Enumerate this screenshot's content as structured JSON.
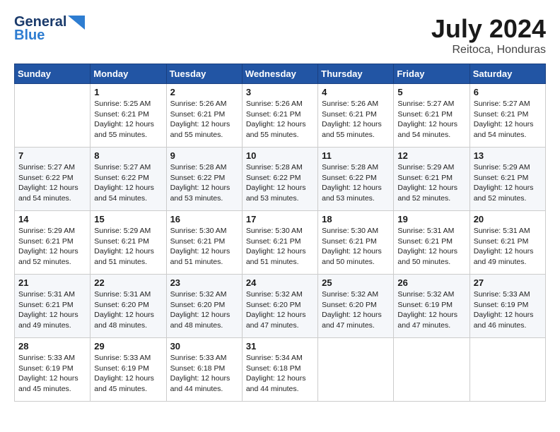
{
  "header": {
    "logo_line1": "General",
    "logo_line2": "Blue",
    "month": "July 2024",
    "location": "Reitoca, Honduras"
  },
  "days_of_week": [
    "Sunday",
    "Monday",
    "Tuesday",
    "Wednesday",
    "Thursday",
    "Friday",
    "Saturday"
  ],
  "weeks": [
    [
      {
        "day": "",
        "info": ""
      },
      {
        "day": "1",
        "info": "Sunrise: 5:25 AM\nSunset: 6:21 PM\nDaylight: 12 hours\nand 55 minutes."
      },
      {
        "day": "2",
        "info": "Sunrise: 5:26 AM\nSunset: 6:21 PM\nDaylight: 12 hours\nand 55 minutes."
      },
      {
        "day": "3",
        "info": "Sunrise: 5:26 AM\nSunset: 6:21 PM\nDaylight: 12 hours\nand 55 minutes."
      },
      {
        "day": "4",
        "info": "Sunrise: 5:26 AM\nSunset: 6:21 PM\nDaylight: 12 hours\nand 55 minutes."
      },
      {
        "day": "5",
        "info": "Sunrise: 5:27 AM\nSunset: 6:21 PM\nDaylight: 12 hours\nand 54 minutes."
      },
      {
        "day": "6",
        "info": "Sunrise: 5:27 AM\nSunset: 6:21 PM\nDaylight: 12 hours\nand 54 minutes."
      }
    ],
    [
      {
        "day": "7",
        "info": "Sunrise: 5:27 AM\nSunset: 6:22 PM\nDaylight: 12 hours\nand 54 minutes."
      },
      {
        "day": "8",
        "info": "Sunrise: 5:27 AM\nSunset: 6:22 PM\nDaylight: 12 hours\nand 54 minutes."
      },
      {
        "day": "9",
        "info": "Sunrise: 5:28 AM\nSunset: 6:22 PM\nDaylight: 12 hours\nand 53 minutes."
      },
      {
        "day": "10",
        "info": "Sunrise: 5:28 AM\nSunset: 6:22 PM\nDaylight: 12 hours\nand 53 minutes."
      },
      {
        "day": "11",
        "info": "Sunrise: 5:28 AM\nSunset: 6:22 PM\nDaylight: 12 hours\nand 53 minutes."
      },
      {
        "day": "12",
        "info": "Sunrise: 5:29 AM\nSunset: 6:21 PM\nDaylight: 12 hours\nand 52 minutes."
      },
      {
        "day": "13",
        "info": "Sunrise: 5:29 AM\nSunset: 6:21 PM\nDaylight: 12 hours\nand 52 minutes."
      }
    ],
    [
      {
        "day": "14",
        "info": "Sunrise: 5:29 AM\nSunset: 6:21 PM\nDaylight: 12 hours\nand 52 minutes."
      },
      {
        "day": "15",
        "info": "Sunrise: 5:29 AM\nSunset: 6:21 PM\nDaylight: 12 hours\nand 51 minutes."
      },
      {
        "day": "16",
        "info": "Sunrise: 5:30 AM\nSunset: 6:21 PM\nDaylight: 12 hours\nand 51 minutes."
      },
      {
        "day": "17",
        "info": "Sunrise: 5:30 AM\nSunset: 6:21 PM\nDaylight: 12 hours\nand 51 minutes."
      },
      {
        "day": "18",
        "info": "Sunrise: 5:30 AM\nSunset: 6:21 PM\nDaylight: 12 hours\nand 50 minutes."
      },
      {
        "day": "19",
        "info": "Sunrise: 5:31 AM\nSunset: 6:21 PM\nDaylight: 12 hours\nand 50 minutes."
      },
      {
        "day": "20",
        "info": "Sunrise: 5:31 AM\nSunset: 6:21 PM\nDaylight: 12 hours\nand 49 minutes."
      }
    ],
    [
      {
        "day": "21",
        "info": "Sunrise: 5:31 AM\nSunset: 6:21 PM\nDaylight: 12 hours\nand 49 minutes."
      },
      {
        "day": "22",
        "info": "Sunrise: 5:31 AM\nSunset: 6:20 PM\nDaylight: 12 hours\nand 48 minutes."
      },
      {
        "day": "23",
        "info": "Sunrise: 5:32 AM\nSunset: 6:20 PM\nDaylight: 12 hours\nand 48 minutes."
      },
      {
        "day": "24",
        "info": "Sunrise: 5:32 AM\nSunset: 6:20 PM\nDaylight: 12 hours\nand 47 minutes."
      },
      {
        "day": "25",
        "info": "Sunrise: 5:32 AM\nSunset: 6:20 PM\nDaylight: 12 hours\nand 47 minutes."
      },
      {
        "day": "26",
        "info": "Sunrise: 5:32 AM\nSunset: 6:19 PM\nDaylight: 12 hours\nand 47 minutes."
      },
      {
        "day": "27",
        "info": "Sunrise: 5:33 AM\nSunset: 6:19 PM\nDaylight: 12 hours\nand 46 minutes."
      }
    ],
    [
      {
        "day": "28",
        "info": "Sunrise: 5:33 AM\nSunset: 6:19 PM\nDaylight: 12 hours\nand 45 minutes."
      },
      {
        "day": "29",
        "info": "Sunrise: 5:33 AM\nSunset: 6:19 PM\nDaylight: 12 hours\nand 45 minutes."
      },
      {
        "day": "30",
        "info": "Sunrise: 5:33 AM\nSunset: 6:18 PM\nDaylight: 12 hours\nand 44 minutes."
      },
      {
        "day": "31",
        "info": "Sunrise: 5:34 AM\nSunset: 6:18 PM\nDaylight: 12 hours\nand 44 minutes."
      },
      {
        "day": "",
        "info": ""
      },
      {
        "day": "",
        "info": ""
      },
      {
        "day": "",
        "info": ""
      }
    ]
  ]
}
